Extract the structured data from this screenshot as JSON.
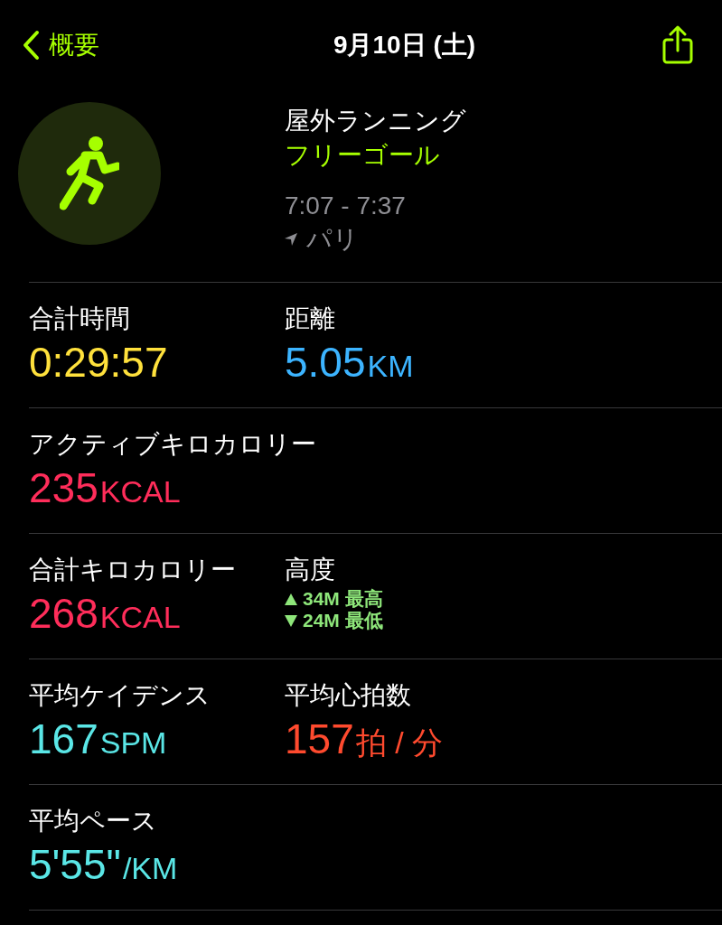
{
  "nav": {
    "back": "概要",
    "title": "9月10日 (土)"
  },
  "workout": {
    "type": "屋外ランニング",
    "goal": "フリーゴール",
    "time": "7:07 - 7:37",
    "location": "パリ"
  },
  "rows": [
    {
      "metrics": [
        {
          "kind": "value",
          "label": "合計時間",
          "number": "0:29:57",
          "color": "#ffe13c"
        },
        {
          "kind": "value",
          "label": "距離",
          "number": "5.05",
          "unit": "KM",
          "color": "#3cb4ff"
        }
      ]
    },
    {
      "metrics": [
        {
          "kind": "value",
          "label": "アクティブキロカロリー",
          "number": "235",
          "unit": "KCAL",
          "color": "#ff2d5a"
        }
      ]
    },
    {
      "metrics": [
        {
          "kind": "value",
          "label": "合計キロカロリー",
          "number": "268",
          "unit": "KCAL",
          "color": "#ff2d5a"
        },
        {
          "kind": "elevation",
          "label": "高度",
          "lines": [
            {
              "kind": "up",
              "text": "34M 最高"
            },
            {
              "kind": "down",
              "text": "24M 最低"
            }
          ],
          "color": "#8ee67a"
        }
      ]
    },
    {
      "metrics": [
        {
          "kind": "value",
          "label": "平均ケイデンス",
          "number": "167",
          "unit": "SPM",
          "color": "#5ae6e6"
        },
        {
          "kind": "value",
          "label": "平均心拍数",
          "number": "157",
          "unit": "拍 / 分",
          "color": "#ff4a2e"
        }
      ]
    },
    {
      "metrics": [
        {
          "kind": "value",
          "label": "平均ペース",
          "number": "5'55\"",
          "unit": "/KM",
          "color": "#5ae6e6"
        }
      ]
    }
  ]
}
